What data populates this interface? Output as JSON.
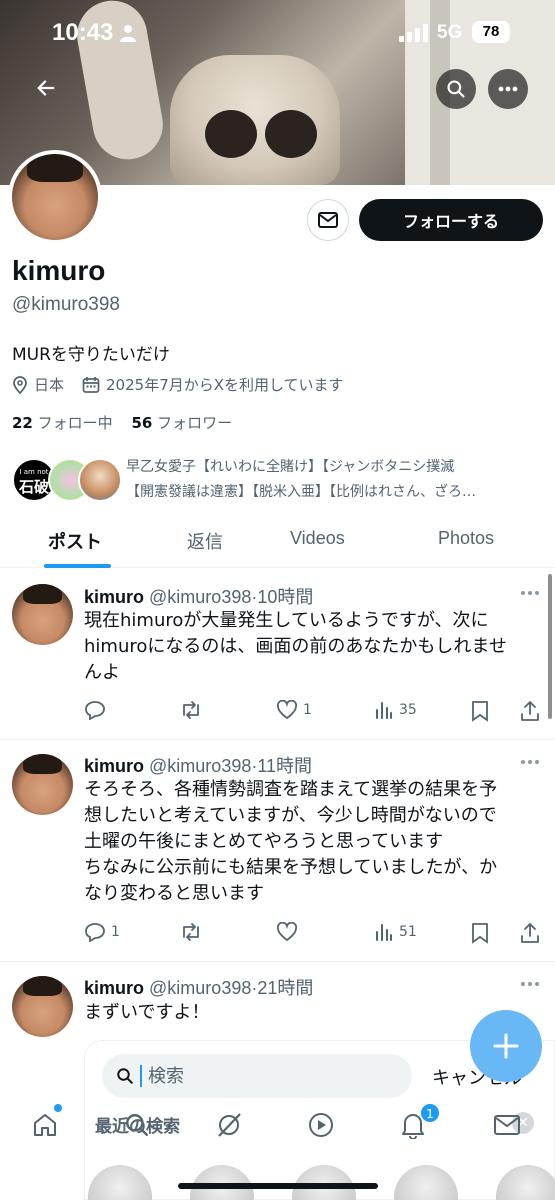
{
  "status_bar": {
    "time": "10:43",
    "network": "5G",
    "battery": "78"
  },
  "profile": {
    "name": "kimuro",
    "handle": "@kimuro398",
    "bio": "MURを守りたいだけ",
    "location": "日本",
    "joined": "2025年7月からXを利用しています",
    "following_count": "22",
    "following_label": "フォロー中",
    "followers_count": "56",
    "followers_label": "フォロワー",
    "follow_button": "フォローする",
    "followed_by_line1": "早乙女愛子【れいわに全賭け】【ジャンボタニシ撲滅",
    "followed_by_line2": "【開憲發議は違憲】【脱米入亜】【比例はれさん、ざろ…",
    "followed_by_avatar1_small": "I am not",
    "followed_by_avatar1_big": "石破"
  },
  "tabs": [
    {
      "label": "ポスト"
    },
    {
      "label": "返信"
    },
    {
      "label": "Videos"
    },
    {
      "label": "Photos"
    }
  ],
  "posts": [
    {
      "name": "kimuro",
      "handle": "@kimuro398",
      "time": "·10時間",
      "lines": [
        "現在himuroが大量発生しているようですが、次に",
        "himuroになるのは、画面の前のあなたかもしれませ",
        "んよ"
      ],
      "replies": "",
      "reposts": "",
      "likes": "1",
      "views": "35"
    },
    {
      "name": "kimuro",
      "handle": "@kimuro398",
      "time": "·11時間",
      "lines": [
        "そろそろ、各種情勢調査を踏まえて選挙の結果を予",
        "想したいと考えていますが、今少し時間がないので",
        "土曜の午後にまとめてやろうと思っています",
        "ちなみに公示前にも結果を予想していましたが、か",
        "なり変わると思います"
      ],
      "replies": "1",
      "reposts": "",
      "likes": "",
      "views": "51"
    },
    {
      "name": "kimuro",
      "handle": "@kimuro398",
      "time": "·21時間",
      "lines": [
        "まずいですよ！"
      ]
    }
  ],
  "search_sheet": {
    "placeholder": "検索",
    "cancel": "キャンセル",
    "recent": "最近の検索"
  },
  "bottom_nav": {
    "notifications_badge": "1"
  },
  "colors": {
    "accent": "#1d9bf0",
    "text": "#0f1419",
    "muted": "#536471",
    "fab": "#68b8f5"
  }
}
